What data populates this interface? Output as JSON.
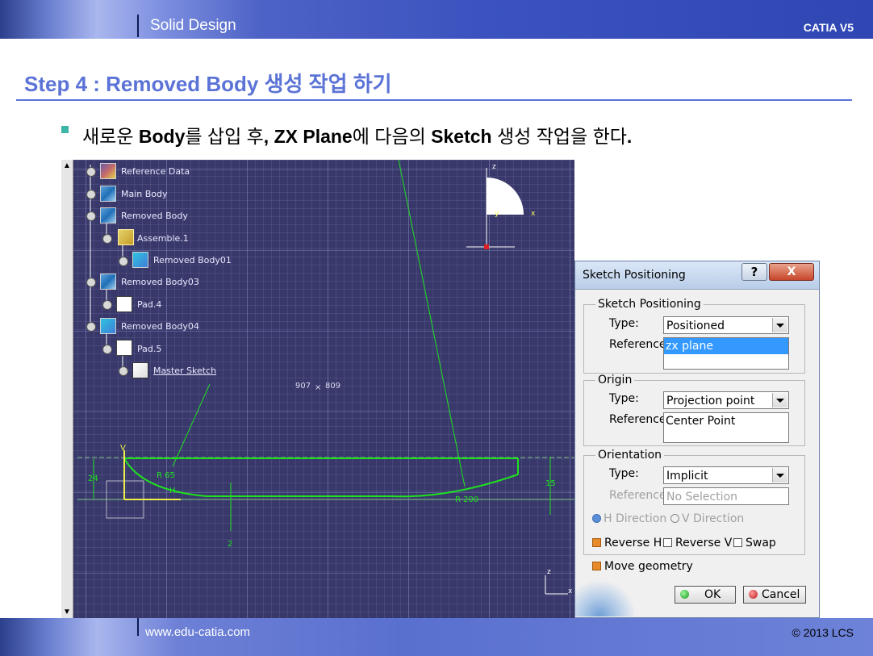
{
  "header": {
    "title": "Solid Design",
    "product": "CATIA V5"
  },
  "slide": {
    "heading": "Step 4 : Removed Body 생성 작업 하기",
    "bullet": {
      "p1": "새로운 ",
      "b1": "Body",
      "p2": "를 삽입 후",
      "b2": ", ZX Plane",
      "p3": "에 다음의 ",
      "b3": "Sketch",
      "p4": " 생성 작업을 한다",
      "b4": "."
    }
  },
  "tree": {
    "items": [
      {
        "label": "Reference Data",
        "icon": "reference-data-icon"
      },
      {
        "label": "Main Body",
        "icon": "body-icon"
      },
      {
        "label": "Removed Body",
        "icon": "body-icon"
      },
      {
        "label": "Assemble.1",
        "icon": "assemble-icon"
      },
      {
        "label": "Removed Body01",
        "icon": "removed-body-icon"
      },
      {
        "label": "Removed Body03",
        "icon": "body-icon"
      },
      {
        "label": "Pad.4",
        "icon": "pad-icon"
      },
      {
        "label": "Removed Body04",
        "icon": "removed-body-icon"
      },
      {
        "label": "Pad.5",
        "icon": "pad-icon"
      },
      {
        "label": "Master Sketch",
        "icon": "sketch-icon"
      }
    ]
  },
  "sketch": {
    "coords": [
      "907",
      "×",
      "809"
    ],
    "dims": {
      "height_left": "24",
      "radius_small": "R 65",
      "h_label": "H",
      "v_label": "V",
      "gap_bottom": "2",
      "height_right": "15",
      "radius_large": "R 200"
    },
    "compass": {
      "z": "z",
      "x": "x",
      "y": "y"
    },
    "axis": {
      "z": "z",
      "x": "x"
    },
    "sketch_color": "#1fe21f",
    "background_color": "#38386a"
  },
  "dialog": {
    "title": "Sketch Positioning",
    "help": "?",
    "close": "X",
    "positioning": {
      "group_label": "Sketch Positioning",
      "type_label": "Type:",
      "type_value": "Positioned",
      "reference_label": "Reference:",
      "reference_value": "zx plane"
    },
    "origin": {
      "group_label": "Origin",
      "type_label": "Type:",
      "type_value": "Projection point",
      "reference_label": "Reference:",
      "reference_value": "Center Point"
    },
    "orientation": {
      "group_label": "Orientation",
      "type_label": "Type:",
      "type_value": "Implicit",
      "reference_label": "Reference:",
      "reference_value": "No Selection",
      "h_direction": "H Direction",
      "v_direction": "V Direction",
      "reverse_h": "Reverse H",
      "reverse_v": "Reverse V",
      "swap": "Swap"
    },
    "move_geometry": "Move geometry",
    "ok": "OK",
    "cancel": "Cancel"
  },
  "footer": {
    "url": "www.edu-catia.com",
    "copyright": "© 2013 LCS"
  }
}
